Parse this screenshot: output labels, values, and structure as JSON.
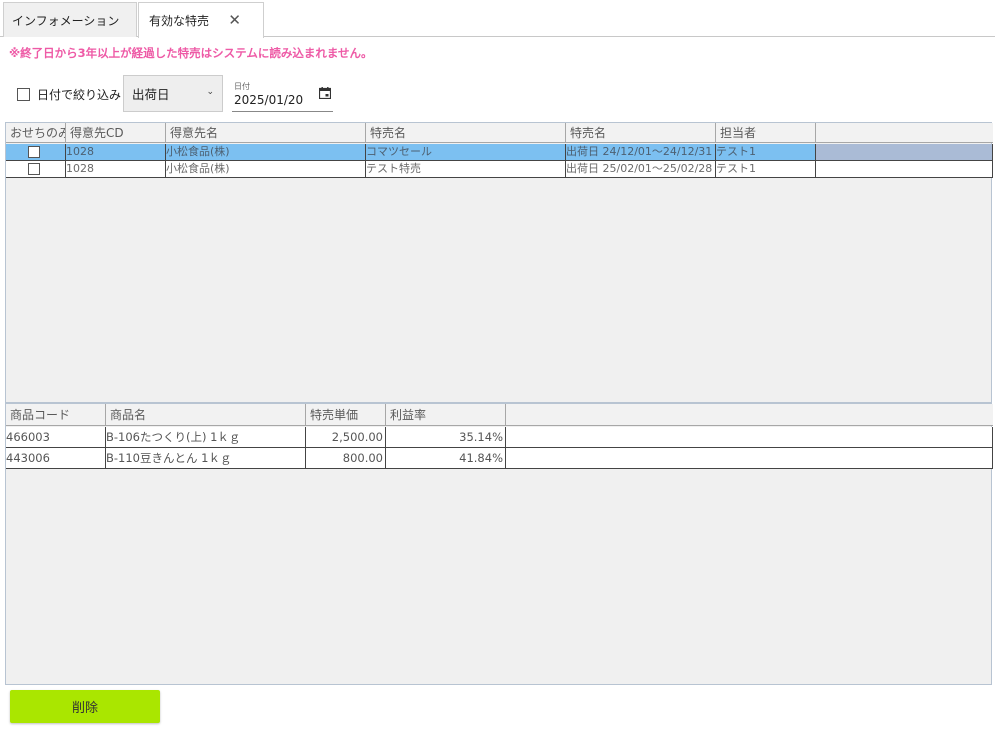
{
  "tabs": [
    {
      "label": "インフォメーション"
    },
    {
      "label": "有効な特売",
      "close": "✕"
    }
  ],
  "warning": "※終了日から3年以上が経過した特売はシステムに読み込まれません。",
  "filter": {
    "checkbox_label": "日付で絞り込み",
    "date_type": "出荷日",
    "date_caption": "日付",
    "date_value": "2025/01/20"
  },
  "sales_grid": {
    "headers": [
      "おせちのみ",
      "得意先CD",
      "得意先名",
      "特売名",
      "特売名",
      "担当者"
    ],
    "rows": [
      {
        "cd": "1028",
        "customer": "小松食品(株)",
        "sale_name": "コマツセール",
        "period": "出荷日 24/12/01～24/12/31",
        "staff": "テスト1"
      },
      {
        "cd": "1028",
        "customer": "小松食品(株)",
        "sale_name": "テスト特売",
        "period": "出荷日 25/02/01～25/02/28",
        "staff": "テスト1"
      }
    ]
  },
  "product_grid": {
    "headers": [
      "商品コード",
      "商品名",
      "特売単価",
      "利益率"
    ],
    "rows": [
      {
        "code": "466003",
        "name": "B-106たつくり(上) 1ｋｇ",
        "price": "2,500.00",
        "margin": "35.14%"
      },
      {
        "code": "443006",
        "name": "B-110豆きんとん 1ｋｇ",
        "price": "800.00",
        "margin": "41.84%"
      }
    ]
  },
  "buttons": {
    "delete": "削除"
  },
  "colors": {
    "accent_green": "#aae600",
    "warning_pink": "#ee5aa6",
    "selection_blue": "#7cc0f1"
  }
}
